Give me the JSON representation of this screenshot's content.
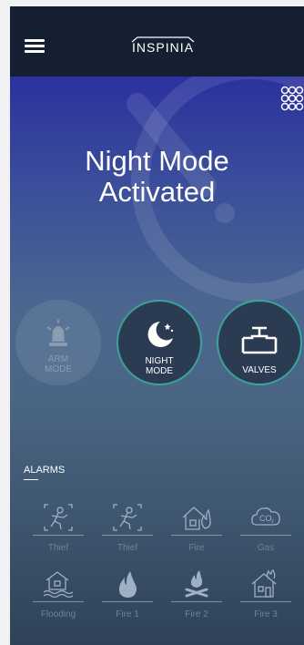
{
  "header": {
    "logo_text": "INSPINIA"
  },
  "status": {
    "headline_line1": "Night Mode",
    "headline_line2": "Activated"
  },
  "modes": [
    {
      "label_line1": "ARM",
      "label_line2": "MODE",
      "icon": "siren-icon",
      "active": false
    },
    {
      "label_line1": "NIGHT",
      "label_line2": "MODE",
      "icon": "moon-icon",
      "active": true
    },
    {
      "label": "VALVES",
      "icon": "valve-icon",
      "active": true
    }
  ],
  "alarms": {
    "title": "ALARMS",
    "items": [
      {
        "label": "Thief",
        "icon": "thief-icon"
      },
      {
        "label": "Thief",
        "icon": "thief-icon"
      },
      {
        "label": "Fire",
        "icon": "fire-house-icon"
      },
      {
        "label": "Gas",
        "icon": "gas-co2-icon"
      },
      {
        "label": "Flooding",
        "icon": "flooding-icon"
      },
      {
        "label": "Fire 1",
        "icon": "flame-icon"
      },
      {
        "label": "Fire 2",
        "icon": "campfire-icon"
      },
      {
        "label": "Fire 3",
        "icon": "burning-house-icon"
      }
    ]
  },
  "colors": {
    "topbar": "#142032",
    "accent_ring": "#3ba39a",
    "inactive_label": "#6f8196"
  }
}
